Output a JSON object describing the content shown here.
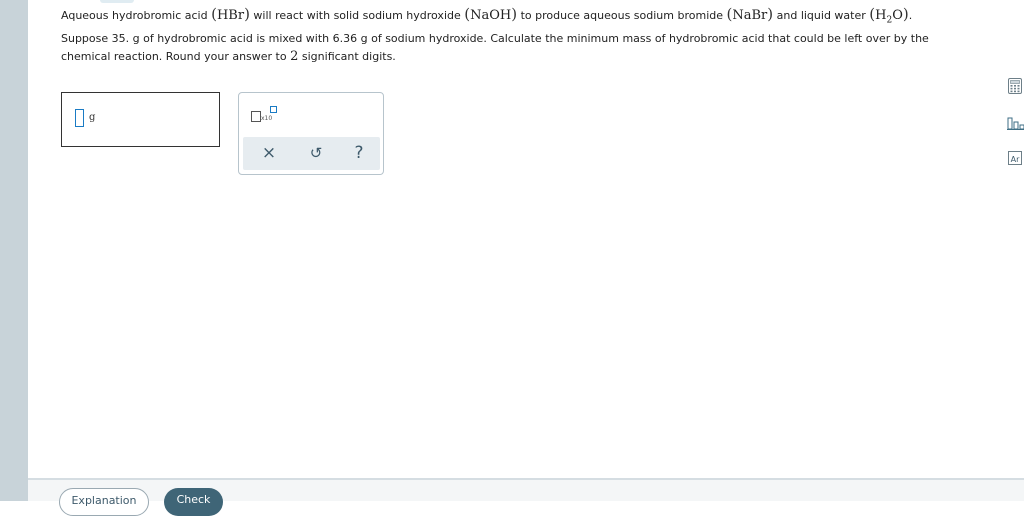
{
  "problem": {
    "intro_1": "Aqueous hydrobromic acid",
    "hbr": "HBr",
    "intro_2": "will react with solid sodium hydroxide",
    "naoh": "NaOH",
    "intro_3": "to produce aqueous sodium bromide",
    "nabr": "NaBr",
    "intro_4": "and liquid water",
    "water_h": "H",
    "water_sub": "2",
    "water_o": "O",
    "period": ".",
    "question": "Suppose 35. g of hydrobromic acid is mixed with 6.36 g of sodium hydroxide. Calculate the minimum mass of hydrobromic acid that could be left over by the chemical reaction. Round your answer to",
    "digits": "2",
    "question_end": "significant digits."
  },
  "answer": {
    "value": "",
    "unit": "g"
  },
  "keypad": {
    "sci_label": "x10",
    "clear_symbol": "×",
    "undo_symbol": "↺",
    "help_symbol": "?"
  },
  "side_tools": [
    "calculator-icon",
    "data-chart-icon",
    "periodic-table-icon"
  ],
  "footer": {
    "explanation_label": "Explanation",
    "check_label": "Check"
  },
  "colors": {
    "rail": "#c8d3d9",
    "accent": "#1a7bc4",
    "check_button": "#3f6577"
  }
}
